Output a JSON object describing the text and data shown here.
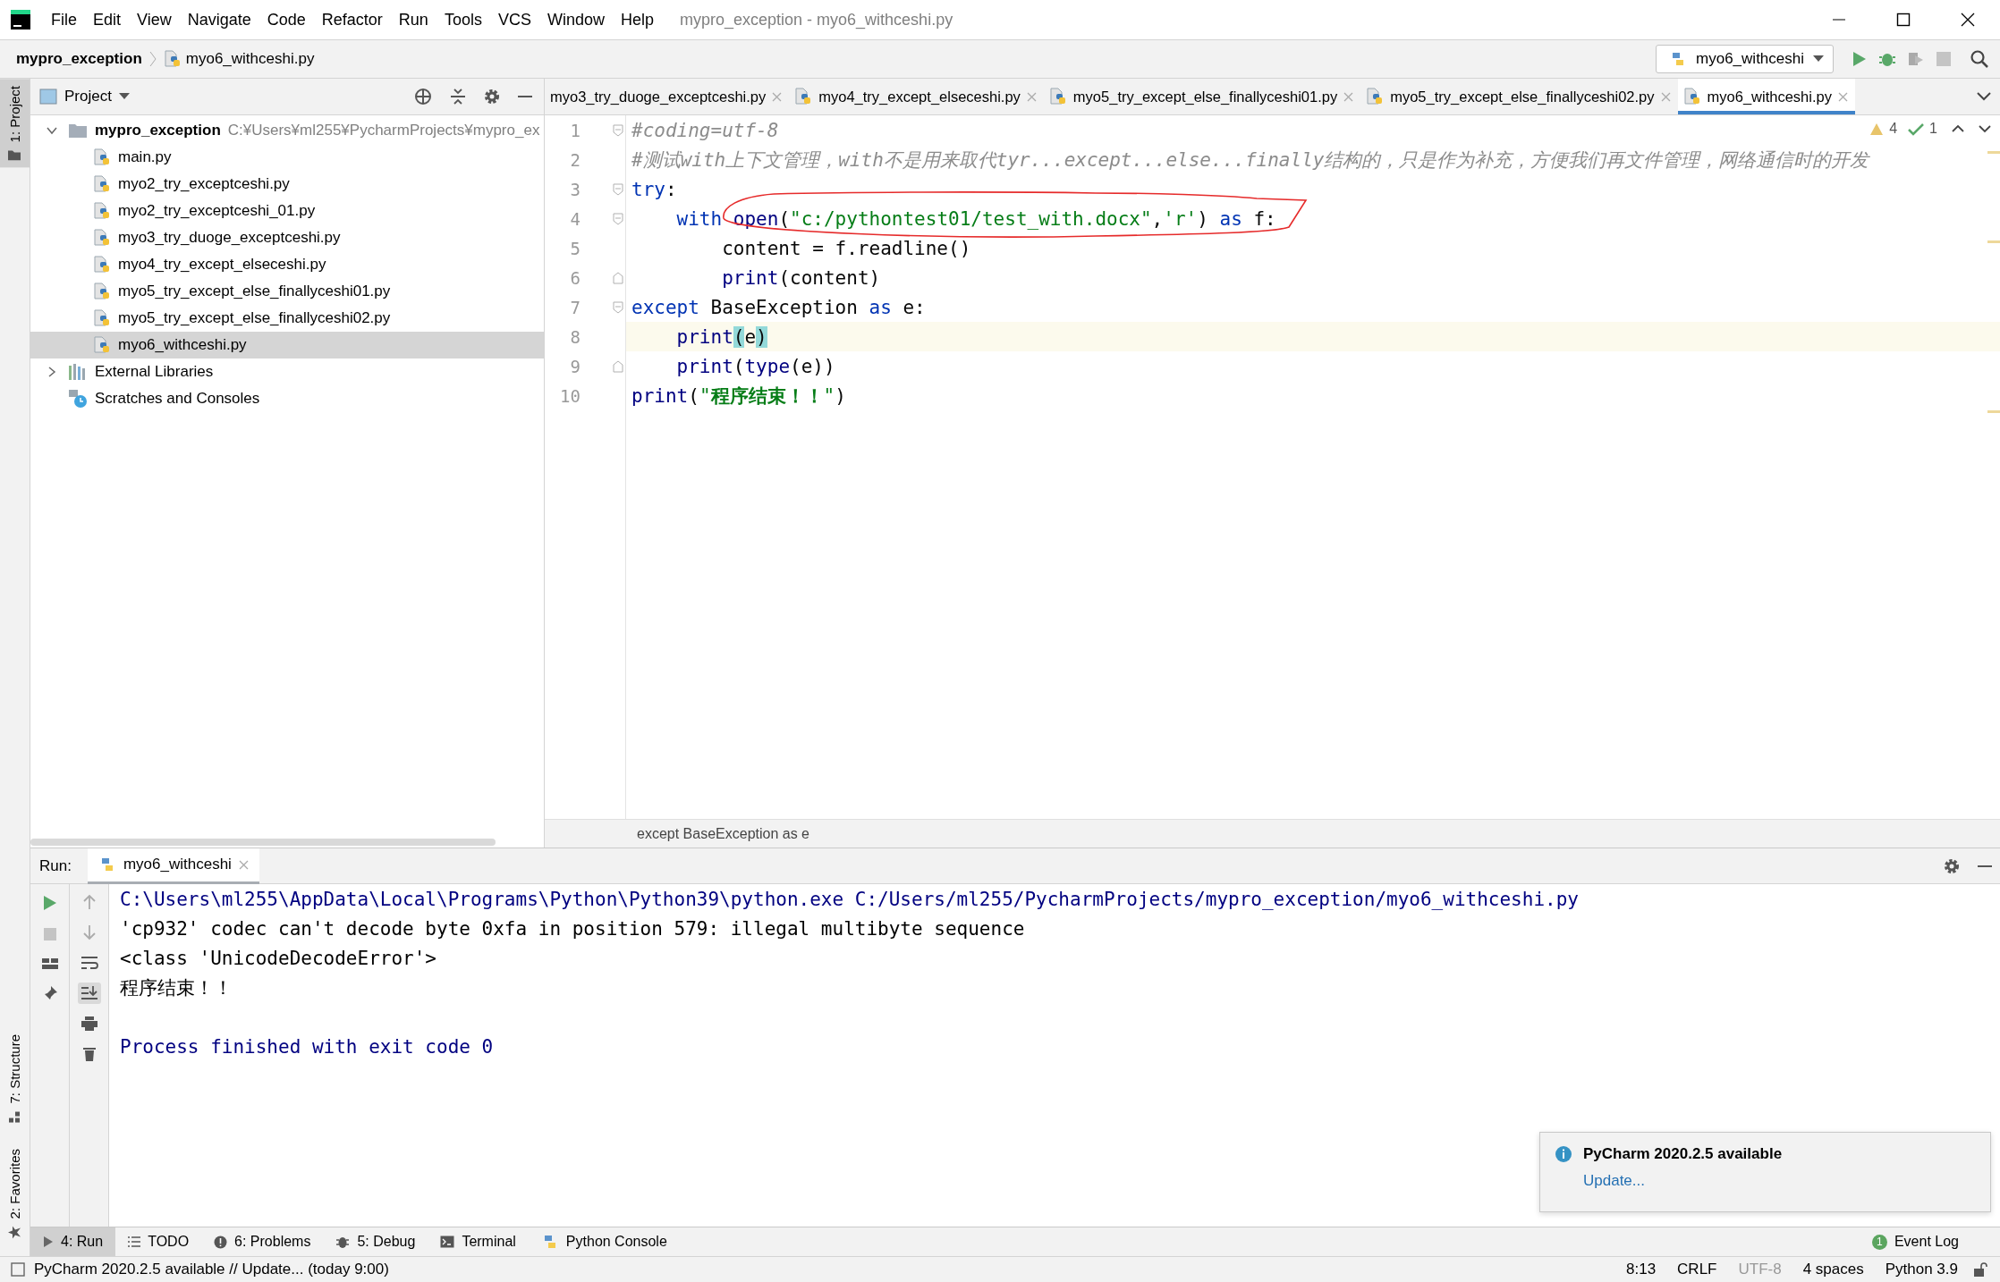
{
  "window": {
    "title": "mypro_exception - myo6_withceshi.py"
  },
  "menu": [
    "File",
    "Edit",
    "View",
    "Navigate",
    "Code",
    "Refactor",
    "Run",
    "Tools",
    "VCS",
    "Window",
    "Help"
  ],
  "breadcrumb": [
    "mypro_exception",
    "myo6_withceshi.py"
  ],
  "run_config": "myo6_withceshi",
  "left_strip": {
    "top": [
      {
        "label": "1: Project",
        "selected": true
      }
    ],
    "bottom": [
      {
        "label": "7: Structure",
        "selected": false
      },
      {
        "label": "2: Favorites",
        "selected": false
      }
    ]
  },
  "project": {
    "title": "Project",
    "tree": [
      {
        "label": "mypro_exception",
        "path": "C:¥Users¥ml255¥PycharmProjects¥mypro_ex",
        "kind": "folder",
        "expanded": true,
        "selected": false,
        "children": [
          {
            "label": "main.py",
            "kind": "python",
            "selected": false
          },
          {
            "label": "myo2_try_exceptceshi.py",
            "kind": "python",
            "selected": false
          },
          {
            "label": "myo2_try_exceptceshi_01.py",
            "kind": "python",
            "selected": false
          },
          {
            "label": "myo3_try_duoge_exceptceshi.py",
            "kind": "python",
            "selected": false
          },
          {
            "label": "myo4_try_except_elseceshi.py",
            "kind": "python",
            "selected": false
          },
          {
            "label": "myo5_try_except_else_finallyceshi01.py",
            "kind": "python",
            "selected": false
          },
          {
            "label": "myo5_try_except_else_finallyceshi02.py",
            "kind": "python",
            "selected": false
          },
          {
            "label": "myo6_withceshi.py",
            "kind": "python",
            "selected": true
          }
        ]
      },
      {
        "label": "External Libraries",
        "kind": "library",
        "expanded": false,
        "selected": false
      },
      {
        "label": "Scratches and Consoles",
        "kind": "scratches",
        "selected": false
      }
    ]
  },
  "editor": {
    "tabs": [
      {
        "label": "myo3_try_duoge_exceptceshi.py",
        "kind": "partial",
        "selected": false
      },
      {
        "label": "myo4_try_except_elseceshi.py",
        "kind": "file",
        "selected": false
      },
      {
        "label": "myo5_try_except_else_finallyceshi01.py",
        "kind": "file",
        "selected": false
      },
      {
        "label": "myo5_try_except_else_finallyceshi02.py",
        "kind": "file",
        "selected": false
      },
      {
        "label": "myo6_withceshi.py",
        "kind": "file",
        "selected": true
      }
    ],
    "inspections": {
      "warnings": "4",
      "passed": "1"
    },
    "lines": [
      {
        "number": "1",
        "fold_start": true,
        "fold_end": false,
        "current": false,
        "tokens": [
          {
            "kind": "comment",
            "text": "#coding=utf-8"
          }
        ]
      },
      {
        "number": "2",
        "fold_start": false,
        "fold_end": false,
        "current": false,
        "tokens": [
          {
            "kind": "comment",
            "text": "#测试with上下文管理，with不是用来取代tyr...except...else...finally结构的，只是作为补充，方便我们再文件管理，网络通信时的开发"
          }
        ]
      },
      {
        "number": "3",
        "fold_start": true,
        "fold_end": false,
        "current": false,
        "tokens": [
          {
            "kind": "keyword",
            "text": "try"
          },
          {
            "kind": "plain",
            "text": ":"
          }
        ]
      },
      {
        "number": "4",
        "fold_start": true,
        "fold_end": false,
        "current": false,
        "tokens": [
          {
            "kind": "keyword",
            "text": "    with "
          },
          {
            "kind": "builtin",
            "text": "open"
          },
          {
            "kind": "plain",
            "text": "("
          },
          {
            "kind": "string",
            "text": "\"c:/pythontest01/test_with.docx\""
          },
          {
            "kind": "plain",
            "text": ","
          },
          {
            "kind": "string",
            "text": "'r'"
          },
          {
            "kind": "plain",
            "text": ") "
          },
          {
            "kind": "keyword",
            "text": "as"
          },
          {
            "kind": "plain",
            "text": " f:"
          }
        ]
      },
      {
        "number": "5",
        "fold_start": false,
        "fold_end": false,
        "current": false,
        "tokens": [
          {
            "kind": "plain",
            "text": "        content = f.readline()"
          }
        ]
      },
      {
        "number": "6",
        "fold_start": false,
        "fold_end": true,
        "current": false,
        "tokens": [
          {
            "kind": "builtin",
            "text": "        print"
          },
          {
            "kind": "plain",
            "text": "(content)"
          }
        ]
      },
      {
        "number": "7",
        "fold_start": true,
        "fold_end": false,
        "current": false,
        "tokens": [
          {
            "kind": "keyword",
            "text": "except"
          },
          {
            "kind": "plain",
            "text": " BaseException "
          },
          {
            "kind": "keyword",
            "text": "as"
          },
          {
            "kind": "plain",
            "text": " e:"
          }
        ]
      },
      {
        "number": "8",
        "fold_start": false,
        "fold_end": false,
        "current": true,
        "tokens": [
          {
            "kind": "builtin",
            "text": "    print"
          },
          {
            "kind": "brace",
            "text": "("
          },
          {
            "kind": "plain",
            "text": "e"
          },
          {
            "kind": "brace",
            "text": ")"
          }
        ]
      },
      {
        "number": "9",
        "fold_start": false,
        "fold_end": true,
        "current": false,
        "tokens": [
          {
            "kind": "builtin",
            "text": "    print"
          },
          {
            "kind": "plain",
            "text": "("
          },
          {
            "kind": "builtin",
            "text": "type"
          },
          {
            "kind": "plain",
            "text": "(e))"
          }
        ]
      },
      {
        "number": "10",
        "fold_start": false,
        "fold_end": false,
        "current": false,
        "tokens": [
          {
            "kind": "builtin",
            "text": "print"
          },
          {
            "kind": "plain",
            "text": "("
          },
          {
            "kind": "string",
            "text": "\"**程序结束！！**\""
          },
          {
            "kind": "plain",
            "text": ")"
          }
        ]
      }
    ],
    "breadcrumb": "except BaseException as e"
  },
  "run": {
    "label": "Run:",
    "tab": "myo6_withceshi",
    "output": [
      {
        "kind": "system",
        "text": "C:\\Users\\ml255\\AppData\\Local\\Programs\\Python\\Python39\\python.exe C:/Users/ml255/PycharmProjects/mypro_exception/myo6_withceshi.py"
      },
      {
        "kind": "stdout",
        "text": "'cp932' codec can't decode byte 0xfa in position 579: illegal multibyte sequence"
      },
      {
        "kind": "stdout",
        "text": "<class 'UnicodeDecodeError'>"
      },
      {
        "kind": "stdout",
        "text": "程序结束！！"
      },
      {
        "kind": "exit",
        "text": "Process finished with exit code 0"
      }
    ]
  },
  "notification": {
    "title": "PyCharm 2020.2.5 available",
    "link": "Update..."
  },
  "tool_tabs": [
    {
      "label": "4: Run",
      "kind": "run",
      "selected": true
    },
    {
      "label": "TODO",
      "kind": "todo",
      "selected": false
    },
    {
      "label": "6: Problems",
      "kind": "problems",
      "selected": false
    },
    {
      "label": "5: Debug",
      "kind": "debug",
      "selected": false
    },
    {
      "label": "Terminal",
      "kind": "terminal",
      "selected": false
    },
    {
      "label": "Python Console",
      "kind": "console",
      "selected": false
    }
  ],
  "event_log": {
    "label": "Event Log",
    "count": "1"
  },
  "status": {
    "message": "PyCharm 2020.2.5 available // Update... (today 9:00)",
    "items": [
      {
        "label": "8:13",
        "disabled": false
      },
      {
        "label": "CRLF",
        "disabled": false
      },
      {
        "label": "UTF-8",
        "disabled": true
      },
      {
        "label": "4 spaces",
        "disabled": false
      },
      {
        "label": "Python 3.9",
        "disabled": false
      }
    ]
  }
}
